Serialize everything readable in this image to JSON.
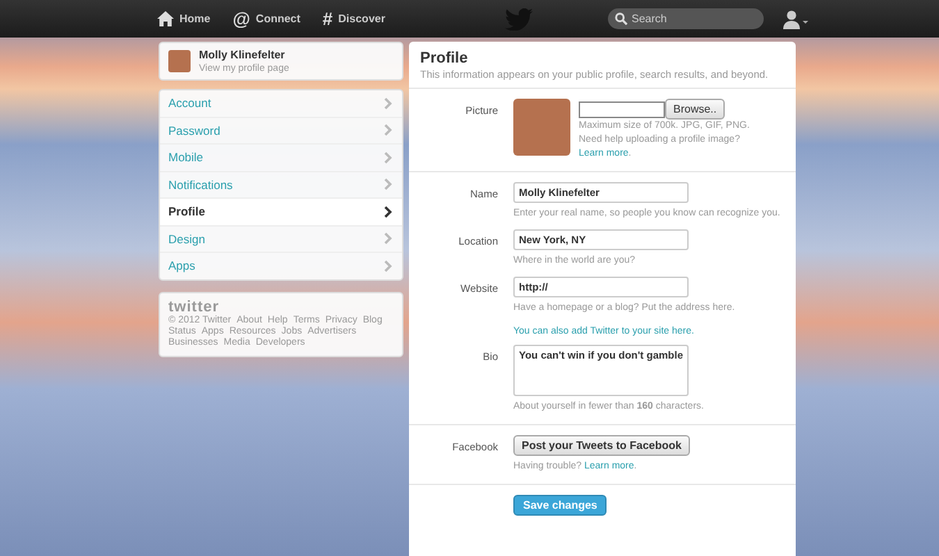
{
  "topbar": {
    "nav": [
      {
        "label": "Home",
        "kind": "drawn"
      },
      {
        "label": "Connect",
        "kind": "glyph",
        "glyph": "@"
      },
      {
        "label": "Discover",
        "kind": "glyph",
        "glyph": "#"
      }
    ],
    "search": {
      "placeholder": "Search"
    }
  },
  "sidebar": {
    "user": {
      "name": "Molly Klinefelter",
      "link": "View my profile page"
    },
    "items": [
      {
        "label": "Account",
        "selected": false
      },
      {
        "label": "Password",
        "selected": false
      },
      {
        "label": "Mobile",
        "selected": false
      },
      {
        "label": "Notifications",
        "selected": false
      },
      {
        "label": "Profile",
        "selected": true
      },
      {
        "label": "Design",
        "selected": false
      },
      {
        "label": "Apps",
        "selected": false
      }
    ],
    "footer": {
      "logo": "twitter",
      "links": [
        "© 2012 Twitter",
        "About",
        "Help",
        "Terms",
        "Privacy",
        "Blog",
        "Status",
        "Apps",
        "Resources",
        "Jobs",
        "Advertisers",
        "Businesses",
        "Media",
        "Developers"
      ]
    }
  },
  "profile": {
    "title": "Profile",
    "subtitle": "This information appears on your public profile, search results, and beyond.",
    "picture": {
      "label": "Picture",
      "browse": "Browse..",
      "hint1": "Maximum size of 700k. JPG, GIF, PNG.",
      "hint2": "Need help uploading a profile image?",
      "link": "Learn more",
      "after": "."
    },
    "fields": [
      {
        "label": "Name",
        "value": "Molly Klinefelter",
        "hint": "Enter your real name, so people you know can recognize you."
      },
      {
        "label": "Location",
        "value": "New York, NY",
        "hint": "Where in the world are you?"
      },
      {
        "label": "Website",
        "value": "http://",
        "hint": "Have a homepage or a blog? Put the address here.",
        "link": "You can also add Twitter to your site here."
      }
    ],
    "bio": {
      "label": "Bio",
      "value": "You can't win if you don't gamble",
      "hint": "About yourself in fewer than **160** characters."
    },
    "facebook": {
      "label": "Facebook",
      "button": "Post your Tweets to Facebook",
      "hint": "Having trouble?",
      "link": "Learn more",
      "after": "."
    },
    "save": "Save changes"
  }
}
